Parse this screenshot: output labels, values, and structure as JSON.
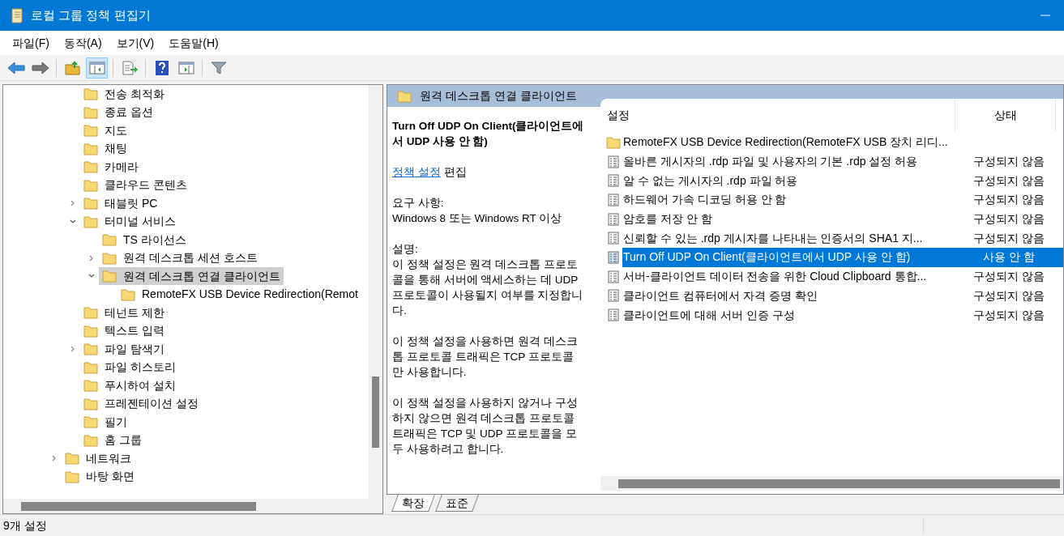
{
  "window": {
    "title": "로컬 그룹 정책 편집기"
  },
  "menu": [
    "파일(F)",
    "동작(A)",
    "보기(V)",
    "도움말(H)"
  ],
  "toolbar": [
    {
      "kind": "back",
      "pressed": false
    },
    {
      "kind": "forward",
      "pressed": false
    },
    {
      "kind": "sep"
    },
    {
      "kind": "up",
      "pressed": false
    },
    {
      "kind": "tree",
      "pressed": true
    },
    {
      "kind": "sep"
    },
    {
      "kind": "export",
      "pressed": false
    },
    {
      "kind": "sep"
    },
    {
      "kind": "help",
      "pressed": false
    },
    {
      "kind": "pane",
      "pressed": false
    },
    {
      "kind": "sep"
    },
    {
      "kind": "filter",
      "pressed": false
    }
  ],
  "tree": {
    "branch": [
      {
        "label": "전송 최적화",
        "selected": false
      },
      {
        "label": "종료 옵션",
        "selected": false
      },
      {
        "label": "지도",
        "selected": false
      },
      {
        "label": "채팅",
        "selected": false
      },
      {
        "label": "카메라",
        "selected": false
      },
      {
        "label": "클라우드 콘텐츠",
        "selected": false
      },
      {
        "label": "태블릿 PC",
        "expanded": false,
        "selected": false
      },
      {
        "label": "터미널 서비스",
        "expanded": true,
        "selected": false,
        "children": [
          {
            "label": "TS 라이선스",
            "selected": false
          },
          {
            "label": "원격 데스크톱 세션 호스트",
            "expanded": false,
            "selected": false
          },
          {
            "label": "원격 데스크톱 연결 클라이언트",
            "expanded": true,
            "selected": true,
            "children": [
              {
                "label": "RemoteFX USB Device Redirection(Remot",
                "selected": false
              }
            ]
          }
        ]
      },
      {
        "label": "테넌트 제한",
        "selected": false
      },
      {
        "label": "텍스트 입력",
        "selected": false
      },
      {
        "label": "파일 탐색기",
        "expanded": false,
        "selected": false
      },
      {
        "label": "파일 히스토리",
        "selected": false
      },
      {
        "label": "푸시하여 설치",
        "selected": false
      },
      {
        "label": "프레젠테이션 설정",
        "selected": false
      },
      {
        "label": "필기",
        "selected": false
      },
      {
        "label": "홈 그룹",
        "selected": false
      }
    ],
    "items": [
      {
        "label": "네트워크",
        "expanded": false,
        "selected": false
      },
      {
        "label": "바탕 화면",
        "selected": false
      }
    ]
  },
  "details": {
    "header": "원격 데스크톱 연결 클라이언트",
    "title": "Turn Off UDP On Client(클라이언트에서 UDP 사용 안 함)",
    "edit_link": "정책 설정",
    "edit_text": "편집",
    "requirements_label": "요구 사항:",
    "requirements": "Windows 8 또는 Windows RT 이상",
    "description_label": "설명:",
    "paragraphs": [
      "이 정책 설정은 원격 데스크톱 프로토콜을 통해 서버에 액세스하는 데 UDP 프로토콜이 사용될지 여부를 지정합니다.",
      "이 정책 설정을 사용하면 원격 데스크톱 프로토콜 트래픽은 TCP 프로토콜만 사용합니다.",
      "이 정책 설정을 사용하지 않거나 구성하지 않으면 원격 데스크톱 프로토콜 트래픽은 TCP 및 UDP 프로토콜을 모두 사용하려고 합니다."
    ]
  },
  "list": {
    "columns": [
      "설정",
      "상태"
    ],
    "rows": [
      {
        "kind": "folder",
        "name": "RemoteFX USB Device Redirection(RemoteFX USB 장치 리디...",
        "selected": false
      },
      {
        "kind": "setting",
        "name": "올바른 게시자의 .rdp 파일 및 사용자의 기본 .rdp 설정 허용",
        "state": "구성되지 않음",
        "selected": false
      },
      {
        "kind": "setting",
        "name": "알 수 없는 게시자의 .rdp 파일 허용",
        "state": "구성되지 않음",
        "selected": false
      },
      {
        "kind": "setting",
        "name": "하드웨어 가속 디코딩 허용 안 함",
        "state": "구성되지 않음",
        "selected": false
      },
      {
        "kind": "setting",
        "name": "암호를 저장 안 함",
        "state": "구성되지 않음",
        "selected": false
      },
      {
        "kind": "setting",
        "name": "신뢰할 수 있는 .rdp 게시자를 나타내는 인증서의 SHA1 지...",
        "state": "구성되지 않음",
        "selected": false
      },
      {
        "kind": "setting",
        "name": "Turn Off UDP On Client(클라이언트에서 UDP 사용 안 함)",
        "state": "사용 안 함",
        "selected": true
      },
      {
        "kind": "setting",
        "name": "서버-클라이언트 데이터 전송을 위한 Cloud Clipboard 통합...",
        "state": "구성되지 않음",
        "selected": false
      },
      {
        "kind": "setting",
        "name": "클라이언트 컴퓨터에서 자격 증명 확인",
        "state": "구성되지 않음",
        "selected": false
      },
      {
        "kind": "setting",
        "name": "클라이언트에 대해 서버 인증 구성",
        "state": "구성되지 않음",
        "selected": false
      }
    ]
  },
  "tabs": [
    {
      "label": "확장",
      "selected": true
    },
    {
      "label": "표준",
      "selected": false
    }
  ],
  "status_bar": "9개 설정"
}
